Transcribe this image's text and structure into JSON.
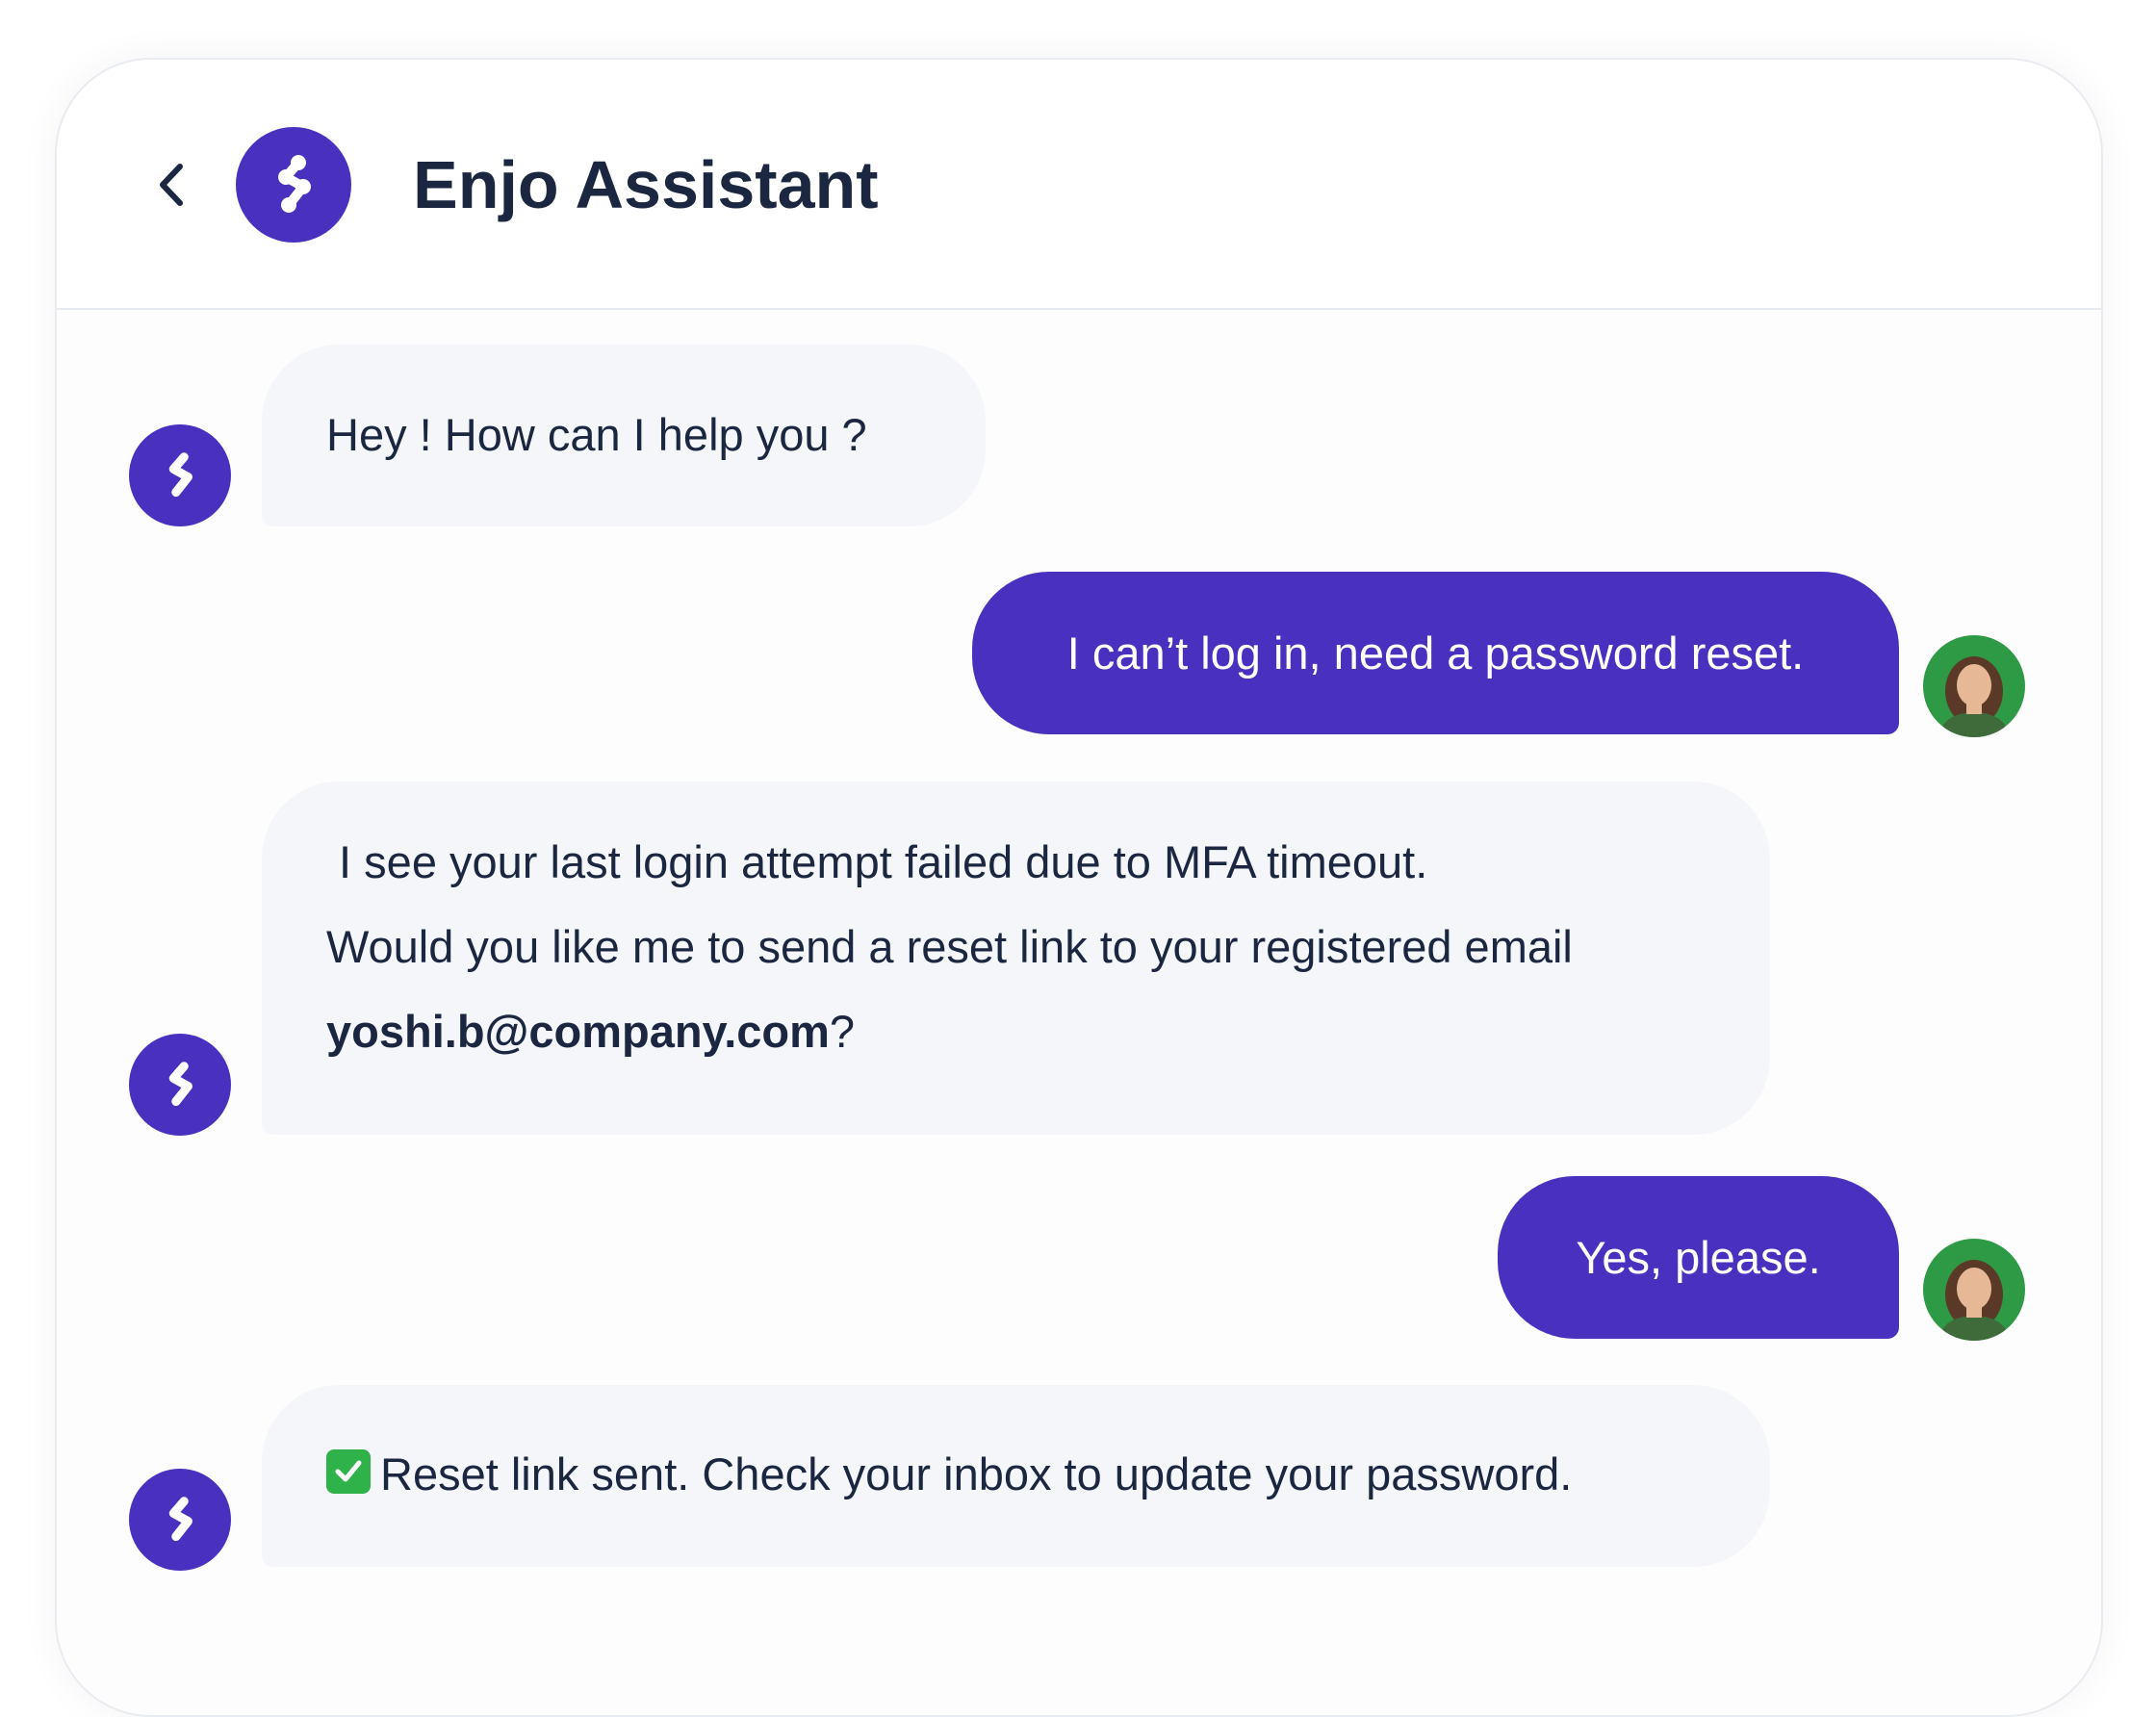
{
  "header": {
    "title": "Enjo Assistant",
    "back_icon": "chevron-left-icon",
    "logo_icon": "enjo-logo-icon"
  },
  "messages": [
    {
      "sender": "bot",
      "lines": [
        "Hey ! How can I help you ?"
      ]
    },
    {
      "sender": "user",
      "text": "I can’t log in, need a password reset."
    },
    {
      "sender": "bot",
      "lines": [
        " I see your last login attempt failed due to MFA timeout.",
        "Would you like me to send a reset link to your registered email"
      ],
      "email": "yoshi.b@company.com",
      "email_suffix": "?"
    },
    {
      "sender": "user",
      "text": "Yes, please."
    },
    {
      "sender": "bot",
      "icon": "checkmark-icon",
      "lines": [
        "Reset link sent. Check your inbox to update your password."
      ]
    }
  ],
  "colors": {
    "brand": "#4a30bf",
    "bot_bubble": "#f5f6fa",
    "text": "#1b2640",
    "check": "#2fb24a"
  }
}
